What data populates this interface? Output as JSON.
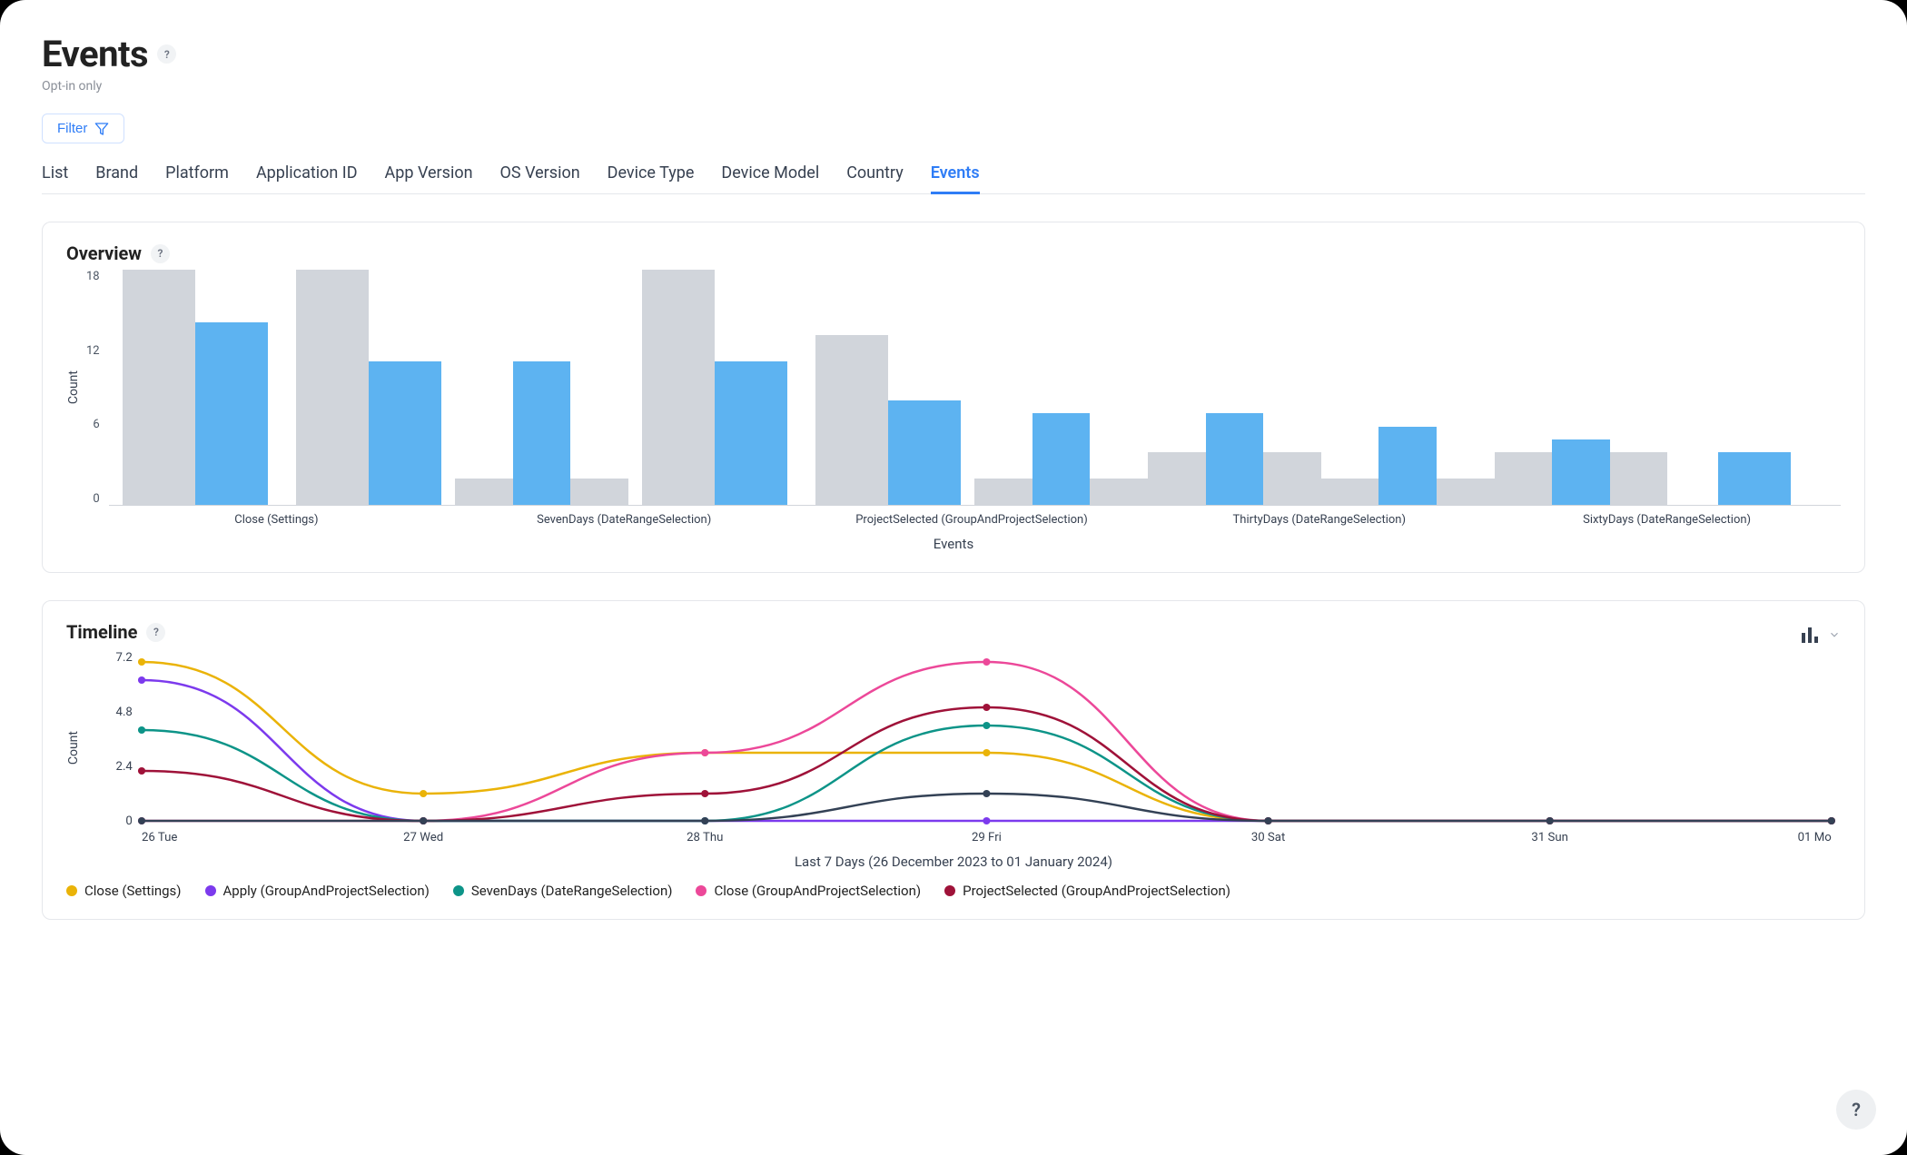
{
  "header": {
    "title": "Events",
    "subtitle": "Opt-in only",
    "filter_label": "Filter"
  },
  "tabs": [
    "List",
    "Brand",
    "Platform",
    "Application ID",
    "App Version",
    "OS Version",
    "Device Type",
    "Device Model",
    "Country",
    "Events"
  ],
  "active_tab_index": 9,
  "overview": {
    "title": "Overview",
    "ylabel": "Count",
    "xlabel": "Events"
  },
  "timeline": {
    "title": "Timeline",
    "caption": "Last 7 Days (26 December 2023 to 01 January 2024)"
  },
  "legend": [
    {
      "label": "Close (Settings)",
      "color": "var(--c-yellow)"
    },
    {
      "label": "Apply (GroupAndProjectSelection)",
      "color": "var(--c-violet)"
    },
    {
      "label": "SevenDays (DateRangeSelection)",
      "color": "var(--c-teal)"
    },
    {
      "label": "Close (GroupAndProjectSelection)",
      "color": "var(--c-pink)"
    },
    {
      "label": "ProjectSelected (GroupAndProjectSelection)",
      "color": "var(--c-maroon)"
    }
  ],
  "chart_data": [
    {
      "id": "overview",
      "type": "bar",
      "ylabel": "Count",
      "xlabel": "Events",
      "ylim": [
        0,
        18
      ],
      "yticks": [
        0,
        6,
        12,
        18
      ],
      "categories": [
        "Close (Settings)",
        "",
        "SevenDays (DateRangeSelection)",
        "",
        "ProjectSelected (GroupAndProjectSelection)",
        "",
        "ThirtyDays (DateRangeSelection)",
        "",
        "SixtyDays (DateRangeSelection)",
        ""
      ],
      "series": [
        {
          "name": "grey",
          "color": "var(--barGrey)",
          "values": [
            19,
            19,
            2,
            2,
            19,
            13,
            2,
            2,
            4,
            4,
            2,
            2,
            4,
            4,
            0,
            0,
            0,
            0,
            0,
            0
          ]
        },
        {
          "name": "blue",
          "color": "var(--barBlue)",
          "values": [
            14,
            0,
            11,
            0,
            11,
            0,
            8,
            0,
            7,
            0,
            7,
            0,
            6,
            0,
            5,
            0,
            4,
            0,
            0,
            0
          ]
        }
      ],
      "pairs": [
        {
          "grey": 19,
          "blue": 14
        },
        {
          "grey": 19,
          "blue": 11
        },
        {
          "grey": 2,
          "blue": 11,
          "grey2": 2
        },
        {
          "grey": 19,
          "blue": 11
        },
        {
          "grey": 13,
          "blue": 8
        },
        {
          "grey": 2,
          "blue": 7,
          "grey2": 2
        },
        {
          "grey": 4,
          "blue": 7,
          "grey2": 4
        },
        {
          "grey": 2,
          "blue": 6,
          "grey2": 2
        },
        {
          "grey": 4,
          "blue": 5,
          "grey2": 4
        },
        {
          "greyNone": true,
          "blue": 4
        }
      ],
      "xlabels": [
        "Close (Settings)",
        "SevenDays (DateRangeSelection)",
        "ProjectSelected (GroupAndProjectSelection)",
        "ThirtyDays (DateRangeSelection)",
        "SixtyDays (DateRangeSelection)"
      ]
    },
    {
      "id": "timeline",
      "type": "line",
      "ylabel": "Count",
      "xlabel": "Last 7 Days (26 December 2023 to 01 January 2024)",
      "ylim": [
        0,
        7.2
      ],
      "yticks": [
        0,
        2.4,
        4.8,
        7.2
      ],
      "x": [
        "26 Tue",
        "27 Wed",
        "28 Thu",
        "29 Fri",
        "30 Sat",
        "31 Sun",
        "01 Mo"
      ],
      "series": [
        {
          "name": "Close (Settings)",
          "color": "var(--c-yellow)",
          "values": [
            7.0,
            1.2,
            3.0,
            3.0,
            0,
            0,
            0
          ]
        },
        {
          "name": "Apply (GroupAndProjectSelection)",
          "color": "var(--c-violet)",
          "values": [
            6.2,
            0,
            0,
            0,
            0,
            0,
            0
          ]
        },
        {
          "name": "SevenDays (DateRangeSelection)",
          "color": "var(--c-teal)",
          "values": [
            4.0,
            0,
            0,
            4.2,
            0,
            0,
            0
          ]
        },
        {
          "name": "Close (GroupAndProjectSelection)",
          "color": "var(--c-pink)",
          "values": [
            0,
            0,
            3.0,
            7.0,
            0,
            0,
            0
          ]
        },
        {
          "name": "ProjectSelected (GroupAndProjectSelection)",
          "color": "var(--c-maroon)",
          "values": [
            2.2,
            0,
            1.2,
            5.0,
            0,
            0,
            0
          ]
        },
        {
          "name": "extra-slate",
          "color": "var(--c-slate)",
          "values": [
            0,
            0,
            0,
            1.2,
            0,
            0,
            0
          ]
        }
      ]
    }
  ]
}
